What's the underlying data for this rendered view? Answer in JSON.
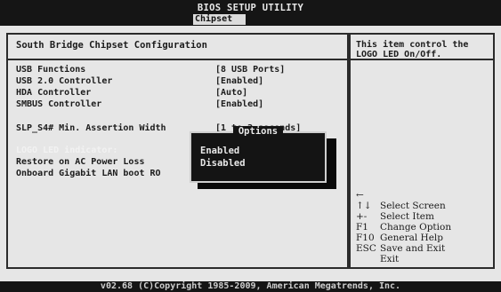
{
  "header": {
    "title": "BIOS SETUP UTILITY",
    "active_tab": "Chipset"
  },
  "main": {
    "section_title": "South Bridge Chipset Configuration",
    "settings": [
      {
        "label": "USB Functions",
        "value": "[8 USB Ports]"
      },
      {
        "label": "USB 2.0 Controller",
        "value": "[Enabled]"
      },
      {
        "label": "HDA Controller",
        "value": "[Auto]"
      },
      {
        "label": "SMBUS Controller",
        "value": "[Enabled]"
      },
      {
        "label": "SLP_S4# Min. Assertion Width",
        "value": "[1 to 2 seconds]"
      },
      {
        "label": "LOGO LED indicator:",
        "value": ""
      },
      {
        "label": "Restore on AC Power Loss",
        "value": ""
      },
      {
        "label": "Onboard Gigabit LAN boot RO",
        "value": ""
      }
    ]
  },
  "popup": {
    "title": "Options",
    "options": [
      "Enabled",
      "Disabled"
    ],
    "selected": "Disabled"
  },
  "help": {
    "text": "This item control the LOGO LED On/Off.",
    "keys": [
      {
        "key": "←",
        "desc": "Select Screen"
      },
      {
        "key": "↑↓",
        "desc": "Select Item"
      },
      {
        "key": "+-",
        "desc": "Change Option"
      },
      {
        "key": "F1",
        "desc": "General Help"
      },
      {
        "key": "F10",
        "desc": "Save and Exit"
      },
      {
        "key": "ESC",
        "desc": "Exit"
      }
    ]
  },
  "footer": {
    "text": "v02.68 (C)Copyright 1985-2009, American Megatrends, Inc."
  }
}
